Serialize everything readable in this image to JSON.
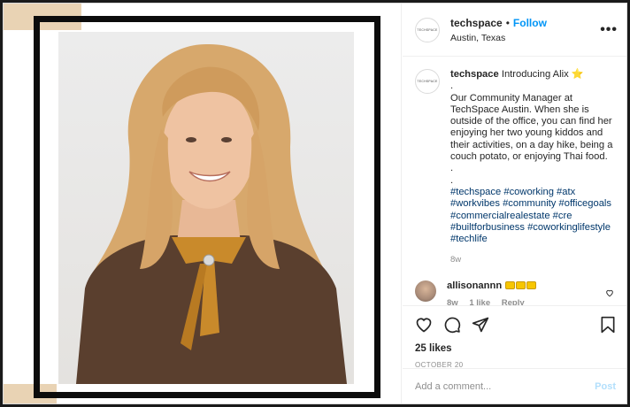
{
  "post": {
    "username": "techspace",
    "separator": "•",
    "follow_label": "Follow",
    "location": "Austin, Texas",
    "more_label": "•••",
    "avatar_text": "TECHSPACE"
  },
  "caption": {
    "username": "techspace",
    "intro": "Introducing Alix",
    "star_emoji": "⭐",
    "dot1": ".",
    "body": "Our Community Manager at TechSpace Austin. When she is outside of the office, you can find her enjoying her two young kiddos and their activities, on a day hike, being a couch potato, or enjoying Thai food.",
    "dot2": ".",
    "dot3": ".",
    "hashtags": [
      "#techspace",
      "#coworking",
      "#atx",
      "#workvibes",
      "#community",
      "#officegoals",
      "#commercialrealestate",
      "#cre",
      "#builtforbusiness",
      "#coworkinglifestyle",
      "#techlife"
    ],
    "time": "8w"
  },
  "comment": {
    "username": "allisonannn",
    "time": "8w",
    "likes": "1 like",
    "reply": "Reply"
  },
  "actions": {
    "likes": "25 likes",
    "date": "OCTOBER 20"
  },
  "add_comment": {
    "placeholder": "Add a comment...",
    "post_label": "Post"
  },
  "colors": {
    "follow": "#0095f6",
    "hashtag": "#00376b",
    "muted": "#8e8e8e",
    "post_disabled": "#b2dffc",
    "frame_tan": "#e9d3b4"
  }
}
